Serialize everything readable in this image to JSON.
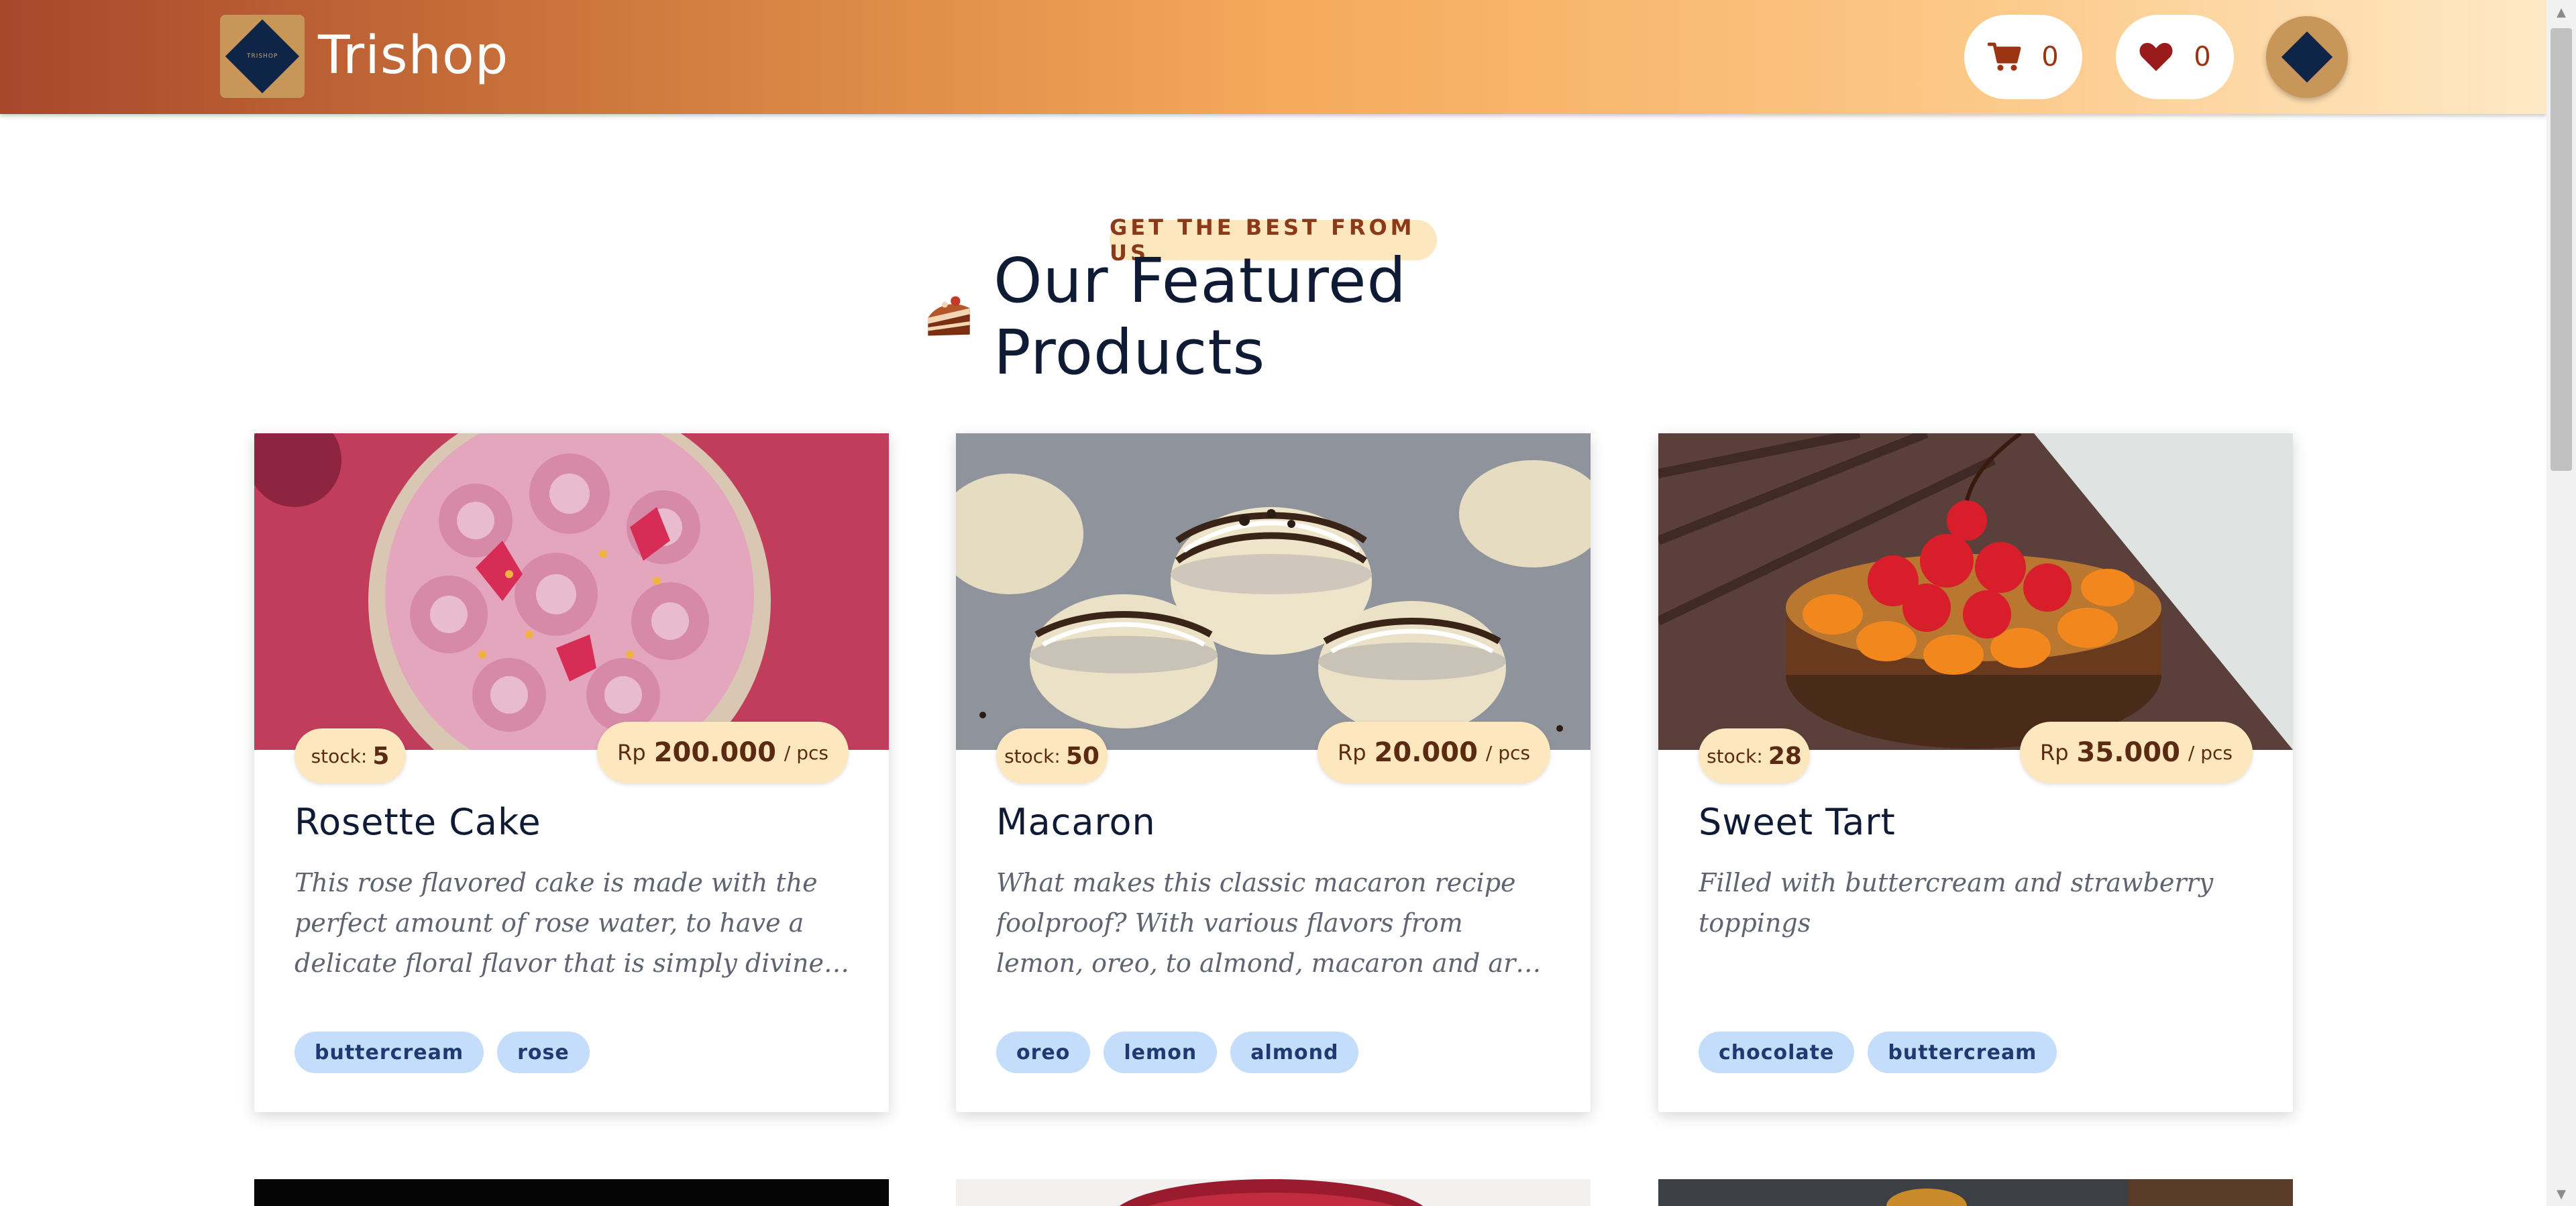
{
  "header": {
    "logo_text": "TRISHOP",
    "brand": "Trishop",
    "cart_count": "0",
    "wishlist_count": "0"
  },
  "hero": {
    "eyebrow": "GET THE BEST FROM US",
    "title": "Our Featured Products"
  },
  "products": [
    {
      "stock_label": "stock:",
      "stock": "5",
      "currency": "Rp",
      "price": "200.000",
      "unit": "/ pcs",
      "name": "Rosette Cake",
      "description": "This rose flavored cake is made with the perfect amount of rose water, to have a delicate floral flavor that is simply divine. It's...",
      "tags": [
        "buttercream",
        "rose"
      ]
    },
    {
      "stock_label": "stock:",
      "stock": "50",
      "currency": "Rp",
      "price": "20.000",
      "unit": "/ pcs",
      "name": "Macaron",
      "description": "What makes this classic macaron recipe foolproof? With various flavors from lemon, oreo, to almond, macaron and are just as...",
      "tags": [
        "oreo",
        "lemon",
        "almond"
      ]
    },
    {
      "stock_label": "stock:",
      "stock": "28",
      "currency": "Rp",
      "price": "35.000",
      "unit": "/ pcs",
      "name": "Sweet Tart",
      "description": "Filled with buttercream and strawberry toppings",
      "tags": [
        "chocolate",
        "buttercream"
      ]
    }
  ],
  "colors": {
    "accent": "#9a3412",
    "badge_bg": "#fde7bf",
    "tag_bg": "#c3ddfb",
    "title": "#0f1b35"
  },
  "icons": {
    "cart": "shopping-cart-icon",
    "wishlist": "heart-icon",
    "section": "cake-slice-icon"
  }
}
